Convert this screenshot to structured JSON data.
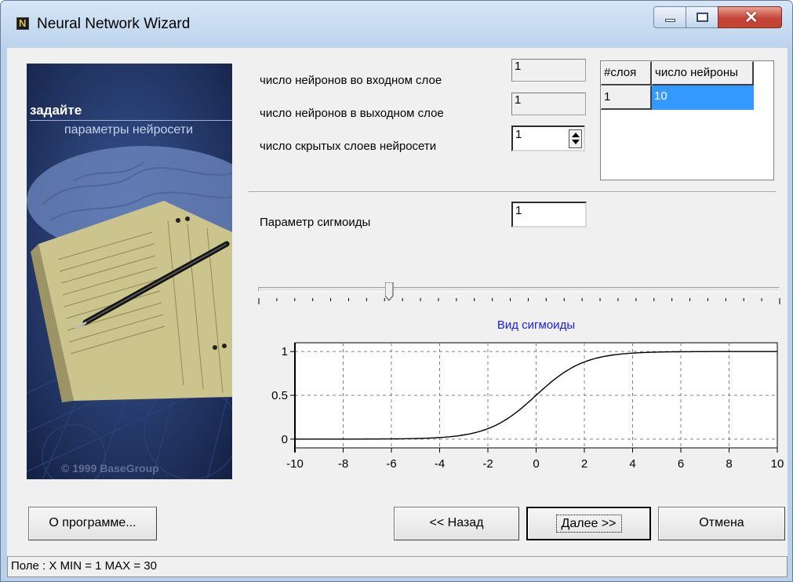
{
  "window": {
    "title": "Neural Network Wizard"
  },
  "image": {
    "heading": "задайте",
    "subheading": "параметры нейросети",
    "copyright": "© 1999 BaseGroup"
  },
  "fields": {
    "input_neurons_label": "число нейронов во входном слое",
    "input_neurons_value": "1",
    "output_neurons_label": "число нейронов в выходном слое",
    "output_neurons_value": "1",
    "hidden_layers_label": "число скрытых слоев нейросети",
    "hidden_layers_value": "1",
    "sigmoid_param_label": "Параметр сигмоиды",
    "sigmoid_param_value": "1"
  },
  "layers_grid": {
    "columns": [
      "#слоя",
      "число нейроны"
    ],
    "rows": [
      [
        "1",
        "10"
      ]
    ]
  },
  "slider": {
    "min": 1,
    "max": 30,
    "value": 1
  },
  "chart_data": {
    "type": "line",
    "title": "Вид сигмоиды",
    "xlabel": "",
    "ylabel": "",
    "xlim": [
      -10,
      10
    ],
    "ylim": [
      -0.1,
      1.1
    ],
    "x_ticks": [
      "-10",
      "-8",
      "-6",
      "-4",
      "-2",
      "0",
      "2",
      "4",
      "6",
      "8",
      "10"
    ],
    "y_ticks": [
      "0",
      "0.5",
      "1"
    ],
    "grid": true,
    "function": "1/(1+exp(-a*x))",
    "a": 1,
    "series": [
      {
        "x": [
          -10,
          -6,
          -4,
          -3,
          -2,
          -1,
          0,
          1,
          2,
          3,
          4,
          6,
          10
        ],
        "y": [
          0.0,
          0.0,
          0.018,
          0.047,
          0.119,
          0.269,
          0.5,
          0.731,
          0.881,
          0.953,
          0.982,
          1.0,
          1.0
        ]
      }
    ],
    "title_color": "#1a1aff",
    "line_color": "#000000"
  },
  "buttons": {
    "about": "О программе...",
    "back": "<< Назад",
    "next": "Далее >>",
    "cancel": "Отмена"
  },
  "status": "Поле : X  MIN = 1 MAX = 30"
}
